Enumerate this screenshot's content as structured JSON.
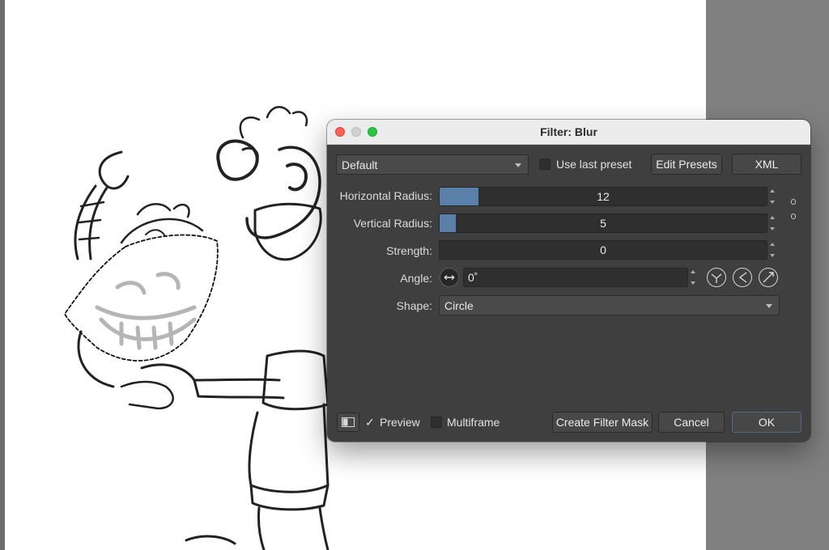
{
  "dialog": {
    "title": "Filter: Blur",
    "preset": "Default",
    "use_last_preset_label": "Use last preset",
    "edit_presets_label": "Edit Presets",
    "xml_label": "XML"
  },
  "params": {
    "horizontal_radius": {
      "label": "Horizontal Radius:",
      "value": "12",
      "fill_fraction": 0.12
    },
    "vertical_radius": {
      "label": "Vertical Radius:",
      "value": "5",
      "fill_fraction": 0.05
    },
    "strength": {
      "label": "Strength:",
      "value": "0",
      "fill_fraction": 0
    },
    "angle": {
      "label": "Angle:",
      "value": "0˚"
    },
    "shape": {
      "label": "Shape:",
      "value": "Circle"
    }
  },
  "footer": {
    "preview_check": "✓",
    "preview_label": "Preview",
    "multiframe_label": "Multiframe",
    "create_mask_label": "Create Filter Mask",
    "cancel_label": "Cancel",
    "ok_label": "OK"
  },
  "colors": {
    "slider_fill": "#5a7fa9",
    "dialog_bg": "#3f3f3f",
    "close": "#fe5f57",
    "maximize": "#28c840"
  },
  "icons": [
    "canvas-sketch",
    "angle-dial-icon",
    "snap-angle-icon",
    "rotate-left-icon",
    "rotate-right-icon",
    "chain-link-icon",
    "split-view-icon"
  ]
}
